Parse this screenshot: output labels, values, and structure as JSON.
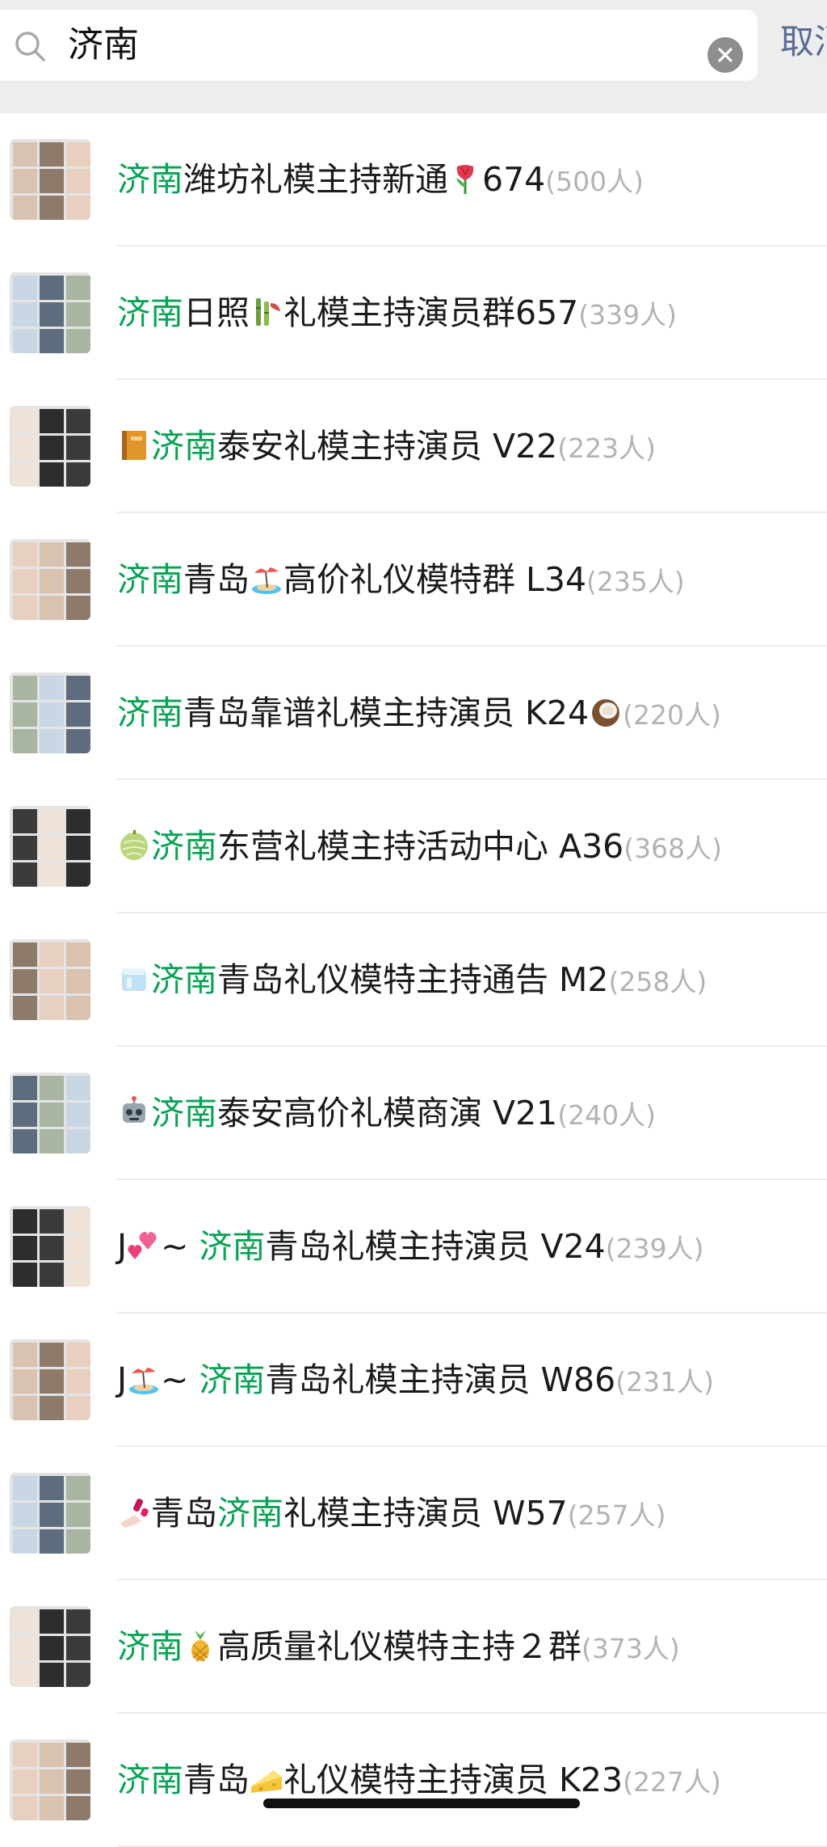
{
  "search": {
    "query": "济南",
    "cancel_label": "取消"
  },
  "results": [
    {
      "prefix": "",
      "emoji_before": "",
      "keyword": "济南",
      "after_kw": "潍坊礼模主持新通",
      "emoji_after": "tulip-icon",
      "suffix": "674",
      "count": "(500人)"
    },
    {
      "prefix": "",
      "emoji_before": "",
      "keyword": "济南",
      "after_kw": "日照",
      "emoji_after": "bamboo-icon",
      "suffix": "礼模主持演员群657",
      "count": "(339人)"
    },
    {
      "prefix": "",
      "emoji_before": "ledger-icon",
      "keyword": "济南",
      "after_kw": "泰安礼模主持演员 V22",
      "emoji_after": "",
      "suffix": "",
      "count": "(223人)"
    },
    {
      "prefix": "",
      "emoji_before": "",
      "keyword": "济南",
      "after_kw": "青岛",
      "emoji_after": "beach-icon",
      "suffix": "高价礼仪模特群 L34",
      "count": "(235人)"
    },
    {
      "prefix": "",
      "emoji_before": "",
      "keyword": "济南",
      "after_kw": "青岛靠谱礼模主持演员 K24",
      "emoji_after": "coconut-icon",
      "suffix": "",
      "count": "(220人)"
    },
    {
      "prefix": "",
      "emoji_before": "melon-icon",
      "keyword": "济南",
      "after_kw": "东营礼模主持活动中心 A36",
      "emoji_after": "",
      "suffix": "",
      "count": "(368人)"
    },
    {
      "prefix": "",
      "emoji_before": "ice-icon",
      "keyword": "济南",
      "after_kw": "青岛礼仪模特主持通告 M2",
      "emoji_after": "",
      "suffix": "",
      "count": "(258人)"
    },
    {
      "prefix": "",
      "emoji_before": "robot-icon",
      "keyword": "济南",
      "after_kw": "泰安高价礼模商演 V21",
      "emoji_after": "",
      "suffix": "",
      "count": "(240人)"
    },
    {
      "prefix": "J",
      "emoji_before": "hearts-icon",
      "tilde": "~ ",
      "keyword": "济南",
      "after_kw": "青岛礼模主持演员 V24",
      "emoji_after": "",
      "suffix": "",
      "count": "(239人)"
    },
    {
      "prefix": "J",
      "emoji_before": "beach-icon",
      "tilde": "~ ",
      "keyword": "济南",
      "after_kw": "青岛礼模主持演员 W86",
      "emoji_after": "",
      "suffix": "",
      "count": "(231人)"
    },
    {
      "prefix": "",
      "emoji_before": "nail-polish-icon",
      "pre_kw": "青岛",
      "keyword": "济南",
      "after_kw": "礼模主持演员 W57",
      "emoji_after": "",
      "suffix": "",
      "count": "(257人)"
    },
    {
      "prefix": "",
      "emoji_before": "",
      "keyword": "济南",
      "after_kw": "",
      "emoji_after": "pineapple-icon",
      "suffix": "高质量礼仪模特主持２群",
      "count": "(373人)"
    },
    {
      "prefix": "",
      "emoji_before": "",
      "keyword": "济南",
      "after_kw": "青岛",
      "emoji_after": "cheese-icon",
      "suffix": "礼仪模特主持演员 K23",
      "count": "(227人)"
    }
  ],
  "colors": {
    "keyword_highlight": "#07a354",
    "cancel_link": "#576b95",
    "count_gray": "#b3b3b3",
    "search_bar_bg": "#ededed",
    "separator": "#ececec"
  }
}
